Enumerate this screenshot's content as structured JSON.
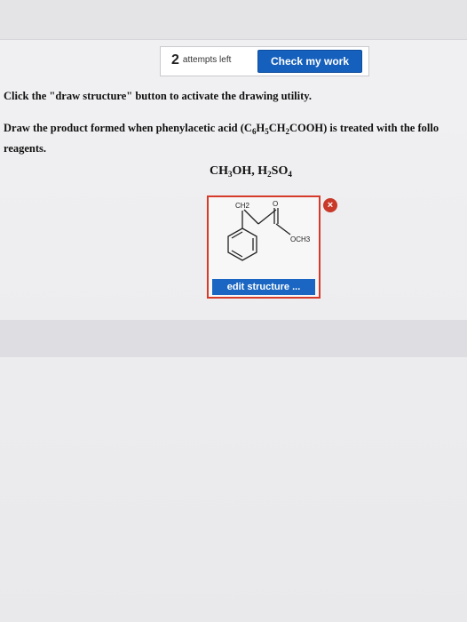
{
  "header": {
    "attempts_number": "2",
    "attempts_label": "attempts left",
    "check_button_label": "Check my work"
  },
  "question": {
    "instruction": "Click the \"draw structure\" button to activate the drawing utility.",
    "prompt_line1": "Draw the product formed when phenylacetic acid (C",
    "prompt_sub1": "6",
    "prompt_mid1": "H",
    "prompt_sub2": "5",
    "prompt_mid2": "CH",
    "prompt_sub3": "2",
    "prompt_end": "COOH) is treated with the follo",
    "prompt_line2": "reagents.",
    "reagents_part1": "CH",
    "reagents_sub1": "3",
    "reagents_part2": "OH, H",
    "reagents_sub2": "2",
    "reagents_part3": "SO",
    "reagents_sub3": "4"
  },
  "structure": {
    "label_ch2": "CH2",
    "label_o": "O",
    "label_och3": "OCH3",
    "edit_button_label": "edit structure ...",
    "remove_icon_glyph": "×"
  },
  "colors": {
    "primary_button": "#1560bd",
    "structure_border": "#d53a2a",
    "remove_button": "#c9392a"
  }
}
